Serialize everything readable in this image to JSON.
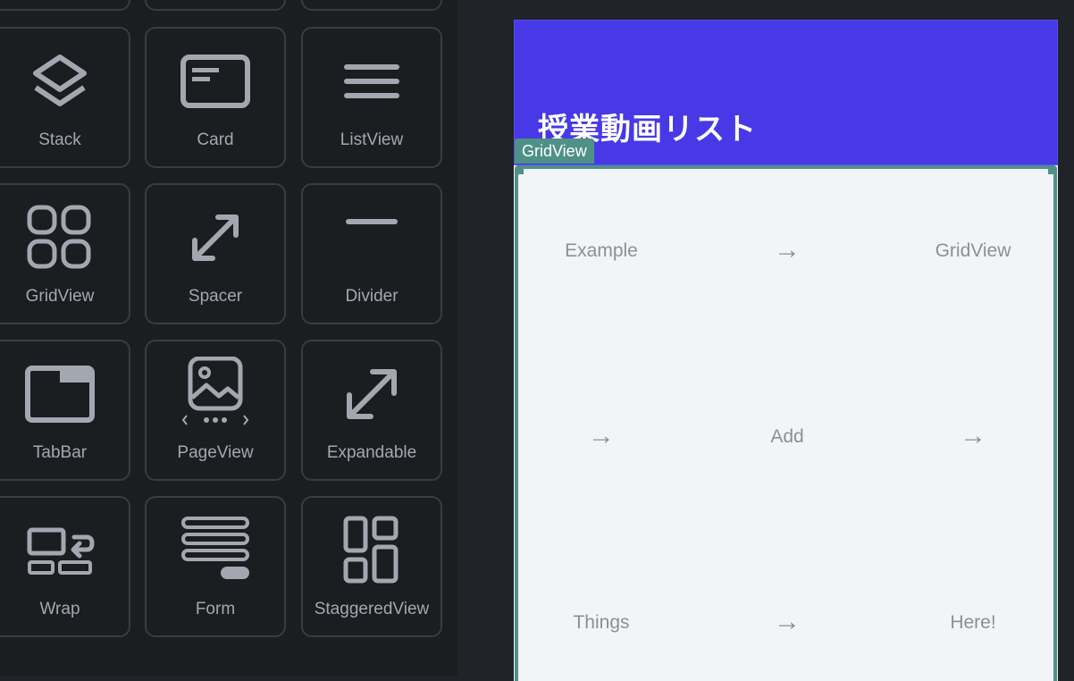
{
  "widget_panel": {
    "widgets": [
      {
        "id": "stack",
        "label": "Stack"
      },
      {
        "id": "card",
        "label": "Card"
      },
      {
        "id": "listview",
        "label": "ListView"
      },
      {
        "id": "gridview",
        "label": "GridView"
      },
      {
        "id": "spacer",
        "label": "Spacer"
      },
      {
        "id": "divider",
        "label": "Divider"
      },
      {
        "id": "tabbar",
        "label": "TabBar"
      },
      {
        "id": "pageview",
        "label": "PageView"
      },
      {
        "id": "expandable",
        "label": "Expandable"
      },
      {
        "id": "wrap",
        "label": "Wrap"
      },
      {
        "id": "form",
        "label": "Form"
      },
      {
        "id": "staggeredview",
        "label": "StaggeredView"
      }
    ]
  },
  "preview": {
    "app_bar_title": "授業動画リスト",
    "selected_widget_tag": "GridView",
    "grid_cells": [
      "Example",
      "→",
      "GridView",
      "→",
      "Add",
      "→",
      "Things",
      "→",
      "Here!"
    ]
  },
  "colors": {
    "app_bar": "#4739e6",
    "selection": "#4f9187",
    "panel_bg": "#1b1d20",
    "card_border": "#383c43",
    "icon": "#a3a8b0"
  }
}
